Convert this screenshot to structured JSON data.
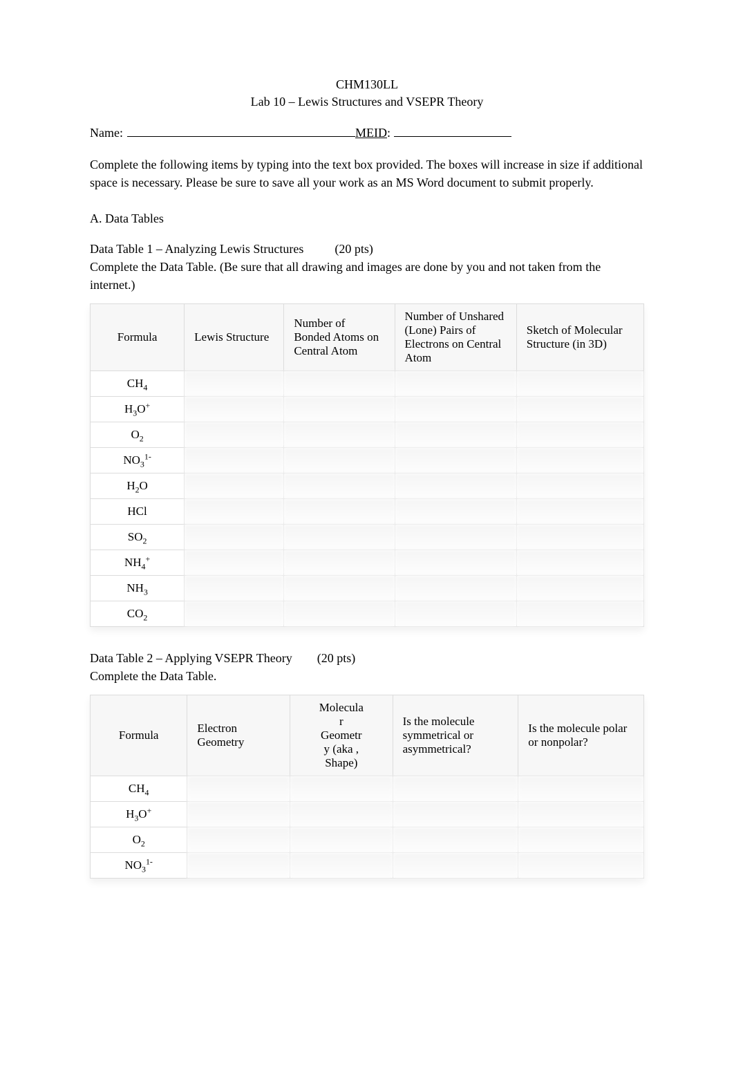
{
  "header": {
    "course": "CHM130LL",
    "lab_title": "Lab 10 – Lewis Structures and VSEPR Theory"
  },
  "name_row": {
    "name_label": "Name:",
    "meid_label": "MEID",
    "colon": ":"
  },
  "intro": "Complete the following items by typing into the text box provided. The boxes will increase in size if additional space is necessary. Please be sure to save all your work as an MS Word document to submit properly.",
  "section_a": "A. Data Tables",
  "table1": {
    "title": "Data Table 1 – Analyzing Lewis Structures",
    "pts": "(20 pts)",
    "instructions": "Complete the Data Table. (Be sure that all drawing and images are done by you and not taken from the internet.)",
    "headers": {
      "c1": "Formula",
      "c2": "Lewis Structure",
      "c3": "Number of Bonded Atoms on Central Atom",
      "c4": "Number of Unshared (Lone) Pairs of Electrons on Central Atom",
      "c5": "Sketch of Molecular Structure (in 3D)"
    },
    "rows": [
      {
        "base": "CH",
        "sub": "4",
        "sup": ""
      },
      {
        "base": "H",
        "sub": "3",
        "mid": "O",
        "sup": "+"
      },
      {
        "base": "O",
        "sub": "2",
        "sup": ""
      },
      {
        "base": "NO",
        "sub": "3",
        "sup": "1-"
      },
      {
        "base": "H",
        "sub": "2",
        "mid": "O",
        "sup": ""
      },
      {
        "base": "HCl",
        "sub": "",
        "sup": ""
      },
      {
        "base": "SO",
        "sub": "2",
        "sup": ""
      },
      {
        "base": "NH",
        "sub": "4",
        "sup": "+"
      },
      {
        "base": "NH",
        "sub": "3",
        "sup": ""
      },
      {
        "base": "CO",
        "sub": "2",
        "sup": ""
      }
    ]
  },
  "table2": {
    "title": "Data Table 2 – Applying VSEPR Theory",
    "pts": "(20 pts)",
    "instructions": "Complete the Data Table.",
    "headers": {
      "c1": "Formula",
      "c2": "Electron Geometry",
      "c3": "Molecular Geometry (aka , Shape)",
      "c4": "Is the molecule symmetrical or asymmetrical?",
      "c5": "Is the molecule polar or nonpolar?"
    },
    "rows": [
      {
        "base": "CH",
        "sub": "4",
        "sup": ""
      },
      {
        "base": "H",
        "sub": "3",
        "mid": "O",
        "sup": "+"
      },
      {
        "base": "O",
        "sub": "2",
        "sup": ""
      },
      {
        "base": "NO",
        "sub": "3",
        "sup": "1-"
      }
    ]
  }
}
